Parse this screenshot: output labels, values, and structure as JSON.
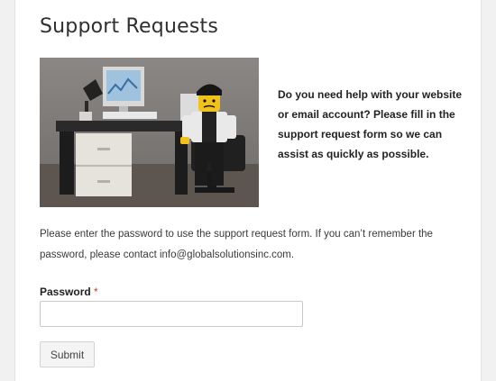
{
  "page": {
    "title": "Support Requests"
  },
  "intro": {
    "text": "Do you need help with your website or email account? Please fill in the support request form so we can assist as quickly as possible."
  },
  "image": {
    "subject": "lego-office-worker-at-desk-photo"
  },
  "notice": {
    "text": "Please enter the password to use the support request form. If you can’t remember the password, please contact info@globalsolutionsinc.com."
  },
  "form": {
    "password_label": "Password",
    "required_marker": "*",
    "password_value": "",
    "submit_label": "Submit"
  },
  "colors": {
    "required": "#c0392b",
    "background": "#f1f1f1"
  }
}
